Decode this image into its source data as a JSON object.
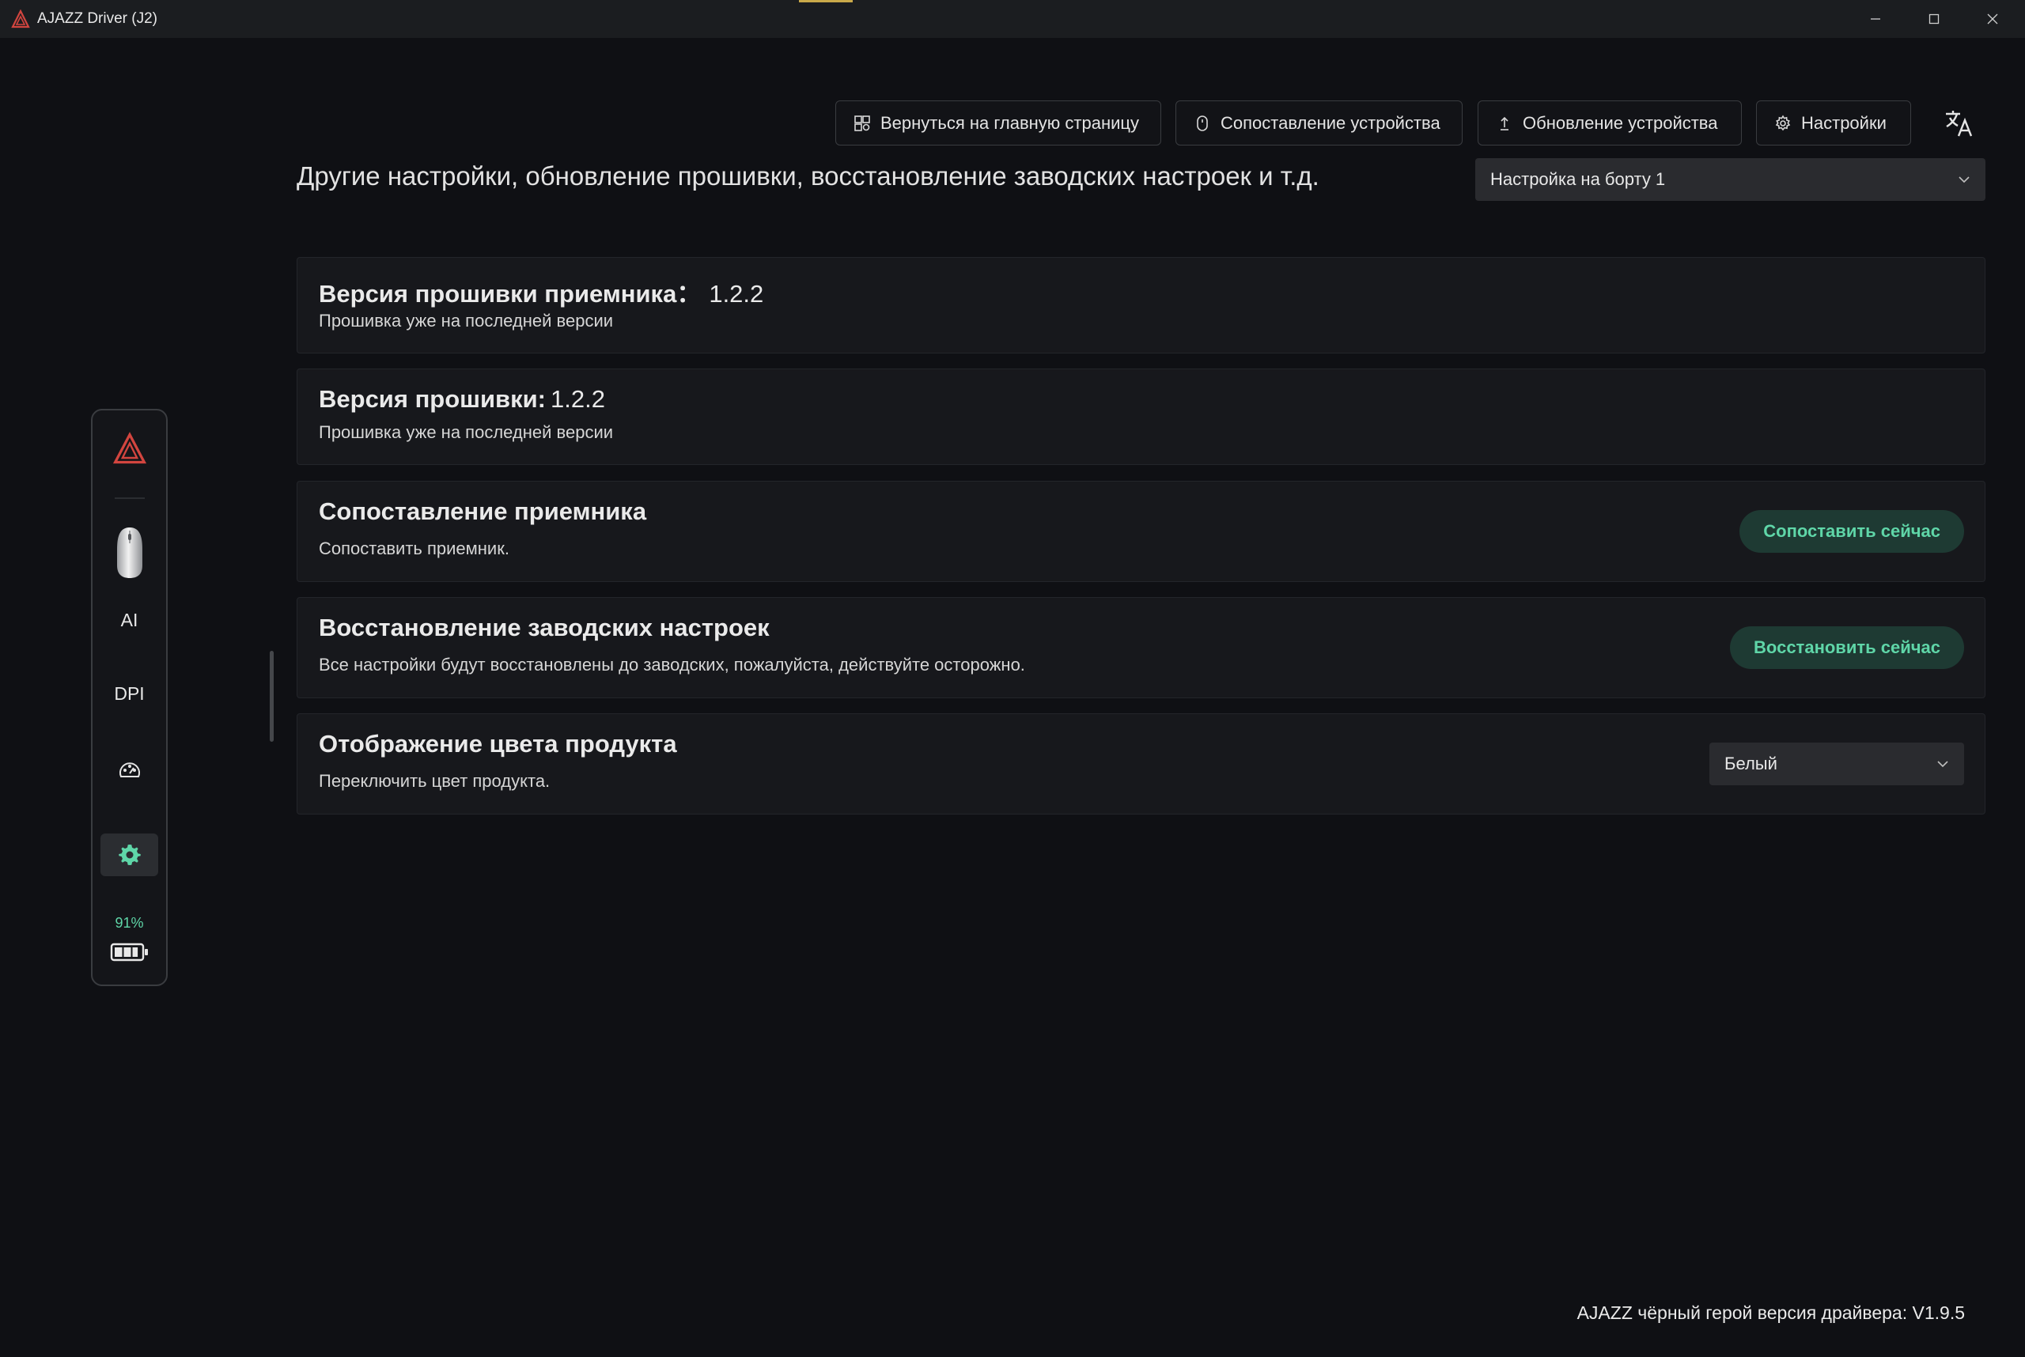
{
  "window": {
    "title": "AJAZZ Driver (J2)"
  },
  "toolbar": {
    "home_label": "Вернуться на главную страницу",
    "pair_device_label": "Сопоставление устройства",
    "update_device_label": "Обновление устройства",
    "settings_label": "Настройки"
  },
  "page": {
    "heading": "Другие настройки, обновление прошивки, восстановление заводских настроек и т.д.",
    "profile_selected": "Настройка на борту 1"
  },
  "cards": {
    "receiver_fw": {
      "title": "Версия прошивки приемника：",
      "version": "1.2.2",
      "desc": "Прошивка уже на последней версии"
    },
    "device_fw": {
      "title": "Версия прошивки:",
      "version": "1.2.2",
      "desc": "Прошивка уже на последней версии"
    },
    "receiver_pair": {
      "title": "Сопоставление приемника",
      "desc": "Сопоставить приемник.",
      "button": "Сопоставить сейчас"
    },
    "factory_reset": {
      "title": "Восстановление заводских настроек",
      "desc": "Все настройки будут восстановлены до заводских, пожалуйста, действуйте осторожно.",
      "button": "Восстановить сейчас"
    },
    "product_color": {
      "title": "Отображение цвета продукта",
      "desc": "Переключить цвет продукта.",
      "selected": "Белый"
    }
  },
  "sidebar": {
    "ai_label": "AI",
    "dpi_label": "DPI",
    "battery_percent": "91%",
    "battery_level": 0.91
  },
  "footer": {
    "version_text": "AJAZZ чёрный герой версия драйвера: V1.9.5"
  },
  "colors": {
    "accent_green": "#5fd6a8",
    "pill_bg": "#1e3a33",
    "logo_red": "#d2453f",
    "background": "#0f1014",
    "card_bg": "#17181c"
  }
}
